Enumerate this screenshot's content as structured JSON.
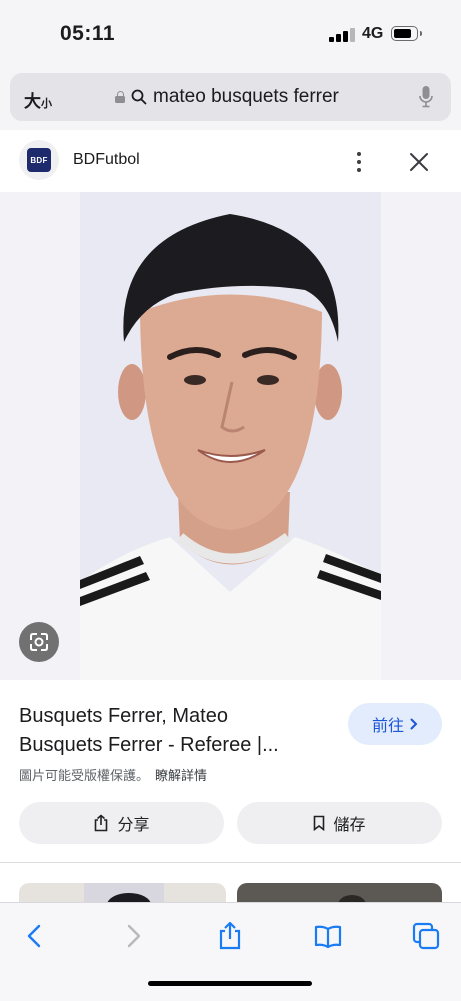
{
  "status_bar": {
    "time": "05:11",
    "network": "4G"
  },
  "address_bar": {
    "text_size_label": "大",
    "text_size_small": "小",
    "query": "mateo busquets ferrer"
  },
  "panel": {
    "site_name": "BDFutbol",
    "logo_text": "BDF"
  },
  "result": {
    "title_line1": "Busquets Ferrer, Mateo",
    "title_line2": "Busquets Ferrer - Referee |...",
    "visit_label": "前往",
    "copyright_text": "圖片可能受版權保護。",
    "learn_more": "瞭解詳情",
    "share_label": "分享",
    "save_label": "儲存"
  },
  "colors": {
    "accent": "#1a56d6",
    "visit_bg": "#e3ecfc",
    "ios_blue": "#1a7cf5"
  },
  "icons": [
    "search-icon",
    "lock-icon",
    "mic-icon",
    "more-icon",
    "close-icon",
    "lens-icon",
    "chevron-right-icon",
    "share-icon",
    "bookmark-icon",
    "back-icon",
    "forward-icon",
    "book-icon",
    "tabs-icon"
  ]
}
